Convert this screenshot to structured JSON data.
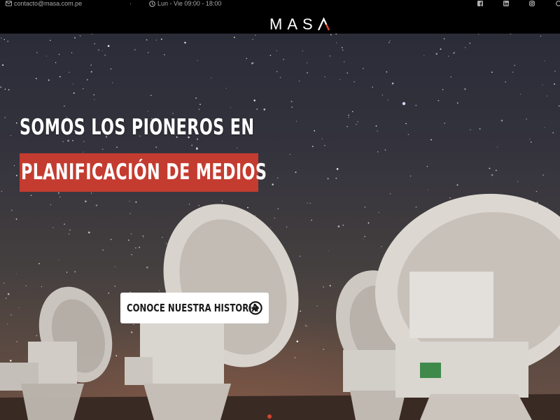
{
  "topbar": {
    "email": "contacto@masa.com.pe",
    "separator": "·",
    "hours": "Lun - Vie 09:00 - 18:00",
    "social": [
      "facebook-icon",
      "linkedin-icon",
      "instagram-icon"
    ]
  },
  "brand": {
    "logo_text": "MAS",
    "logo_last_letter": "A",
    "accent_color": "#d4452f"
  },
  "hero": {
    "headline_line1": "SOMOS LOS PIONEROS EN",
    "headline_line2": "PLANIFICACIÓN DE MEDIOS",
    "highlight_color": "#c43c30",
    "cta_label": "CONOCE NUESTRA HISTORIA",
    "cta_icon": "arrow-circle-right-icon",
    "slider": {
      "active_index": 1,
      "total_visible": 1
    }
  }
}
